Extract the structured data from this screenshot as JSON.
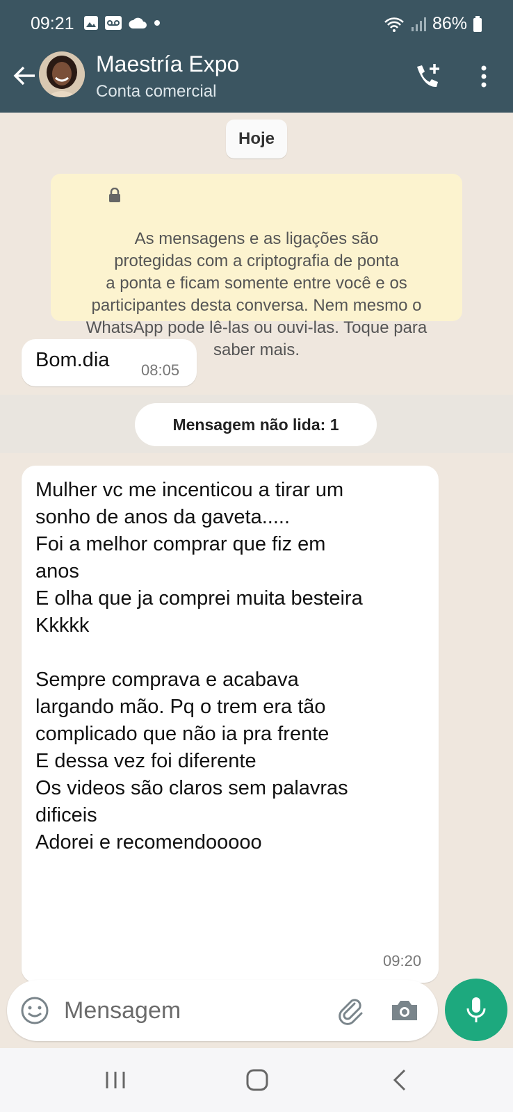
{
  "status_bar": {
    "time": "09:21",
    "battery": "86%",
    "icons": [
      "gallery-icon",
      "voicemail-icon",
      "cloud-icon",
      "dot-icon",
      "wifi-icon",
      "signal-icon",
      "battery-icon"
    ]
  },
  "header": {
    "title": "Maestría Expo",
    "subtitle": "Conta comercial",
    "color": "#3b5561"
  },
  "chat": {
    "date_chip": "Hoje",
    "encryption_notice": "As mensagens e as ligações são\nprotegidas com a criptografia de ponta\na ponta e ficam somente entre você e os\nparticipantes desta conversa. Nem mesmo o\nWhatsApp pode lê-las ou ouvi-las. Toque para\nsaber mais.",
    "messages": [
      {
        "text": "Bom.dia",
        "time": "08:05"
      },
      {
        "text": "Mulher vc me incenticou a tirar um\nsonho de anos  da gaveta.....\nFoi a melhor comprar que fiz em\nanos\nE olha que ja comprei muita besteira\nKkkkk\n\nSempre comprava e acabava\nlargando mão. Pq o trem era tão\ncomplicado que não ia pra frente\nE dessa vez foi diferente\nOs videos são claros sem palavras\ndificeis\nAdorei e recomendooooo",
        "time": "09:20"
      }
    ],
    "unread_label": "Mensagem não lida: 1"
  },
  "composer": {
    "placeholder": "Mensagem",
    "accent": "#1da97e"
  }
}
